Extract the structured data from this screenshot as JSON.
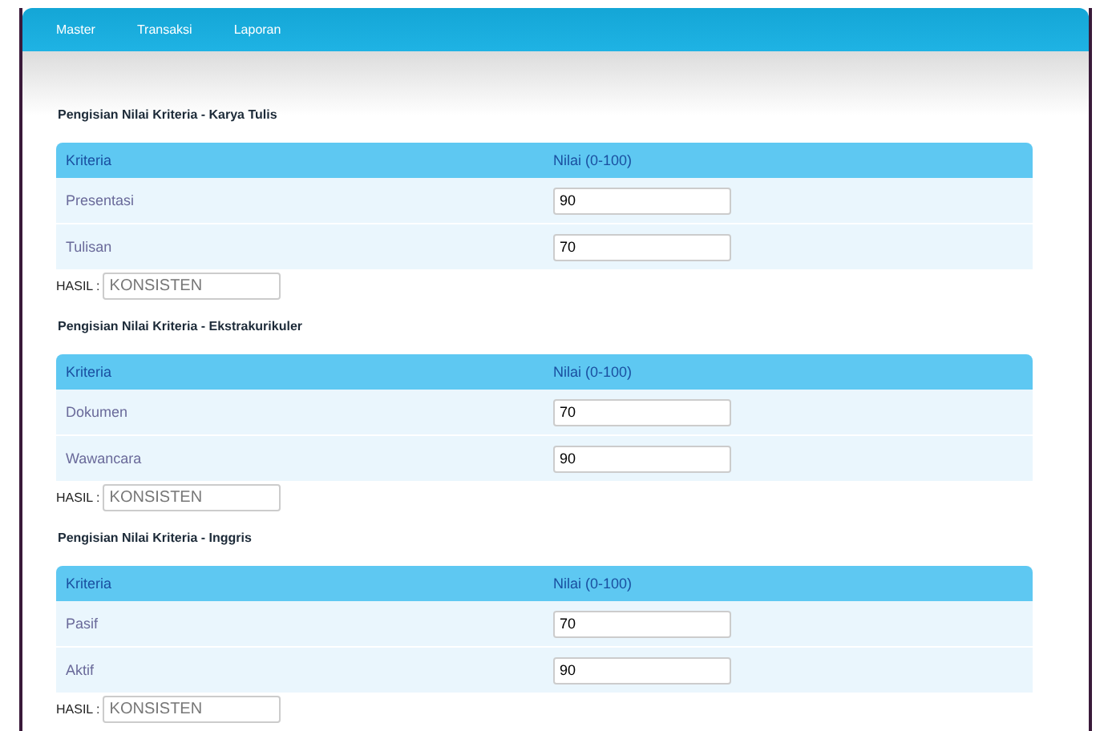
{
  "nav": [
    "Master",
    "Transaksi",
    "Laporan"
  ],
  "sections": [
    {
      "title": "Pengisian Nilai Kriteria - Karya Tulis",
      "columns": [
        "Kriteria",
        "Nilai (0-100)"
      ],
      "rows": [
        {
          "kriteria": "Presentasi",
          "nilai": "90"
        },
        {
          "kriteria": "Tulisan",
          "nilai": "70"
        }
      ],
      "hasil_label": "HASIL :",
      "hasil": "KONSISTEN"
    },
    {
      "title": "Pengisian Nilai Kriteria - Ekstrakurikuler",
      "columns": [
        "Kriteria",
        "Nilai (0-100)"
      ],
      "rows": [
        {
          "kriteria": "Dokumen",
          "nilai": "70"
        },
        {
          "kriteria": "Wawancara",
          "nilai": "90"
        }
      ],
      "hasil_label": "HASIL :",
      "hasil": "KONSISTEN"
    },
    {
      "title": "Pengisian Nilai Kriteria - Inggris",
      "columns": [
        "Kriteria",
        "Nilai (0-100)"
      ],
      "rows": [
        {
          "kriteria": "Pasif",
          "nilai": "70"
        },
        {
          "kriteria": "Aktif",
          "nilai": "90"
        }
      ],
      "hasil_label": "HASIL :",
      "hasil": "KONSISTEN"
    }
  ]
}
